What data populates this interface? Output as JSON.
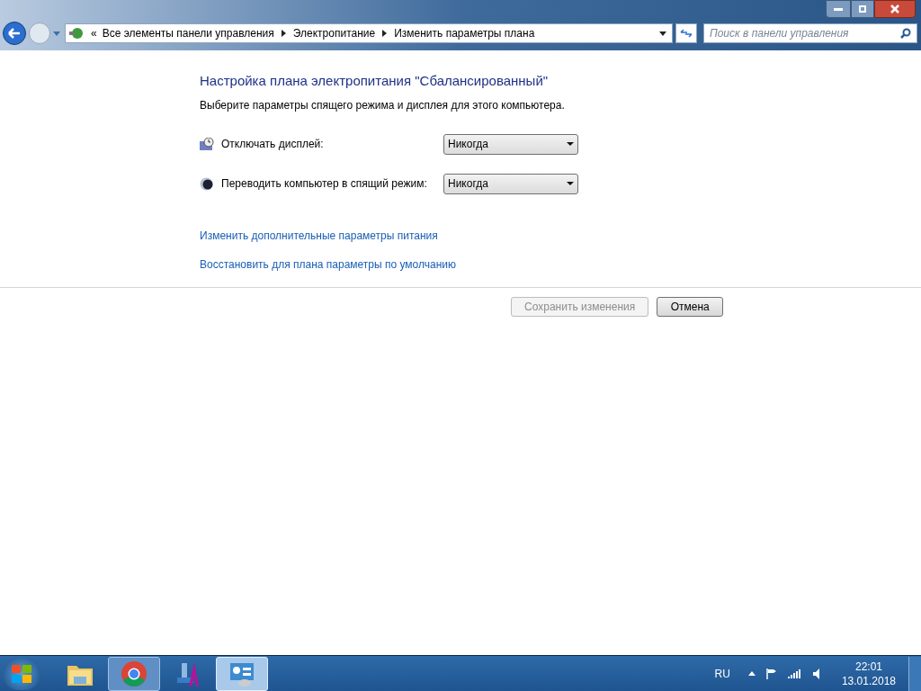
{
  "address_bar": {
    "overflow": "«",
    "crumbs": [
      "Все элементы панели управления",
      "Электропитание",
      "Изменить параметры плана"
    ]
  },
  "search": {
    "placeholder": "Поиск в панели управления"
  },
  "title": "Настройка плана электропитания \"Сбалансированный\"",
  "subtitle": "Выберите параметры спящего режима и дисплея для этого компьютера.",
  "settings": [
    {
      "kind": "display",
      "label": "Отключать дисплей:",
      "value": "Никогда"
    },
    {
      "kind": "sleep",
      "label": "Переводить компьютер в спящий режим:",
      "value": "Никогда"
    }
  ],
  "links": [
    "Изменить дополнительные параметры питания",
    "Восстановить для плана параметры по умолчанию"
  ],
  "buttons": [
    {
      "label": "Сохранить изменения",
      "disabled": true
    },
    {
      "label": "Отмена",
      "disabled": false
    }
  ],
  "taskbar": {
    "items": [
      {
        "kind": "explorer",
        "open": false,
        "selected": false
      },
      {
        "kind": "chrome",
        "open": true,
        "selected": false
      },
      {
        "kind": "font",
        "open": false,
        "selected": false
      },
      {
        "kind": "control-panel",
        "open": true,
        "selected": true
      }
    ],
    "language": "RU",
    "time": "22:01",
    "date": "13.01.2018"
  }
}
